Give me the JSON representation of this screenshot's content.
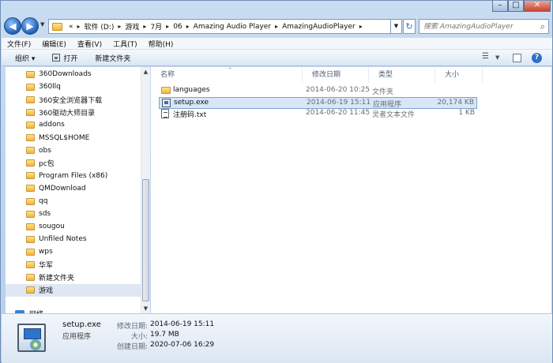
{
  "window": {
    "controls": {
      "minimize": "–",
      "maximize": "□",
      "close": "✕"
    }
  },
  "address": {
    "prefix": "«",
    "crumbs": [
      "软件 (D:)",
      "游戏",
      "7月",
      "06",
      "Amazing Audio Player",
      "AmazingAudioPlayer"
    ],
    "separator": "▸"
  },
  "search": {
    "placeholder": "搜索 AmazingAudioPlayer"
  },
  "menu": [
    "文件(F)",
    "编辑(E)",
    "查看(V)",
    "工具(T)",
    "帮助(H)"
  ],
  "toolbar": {
    "organize": "组织 ▾",
    "open": "打开",
    "new_folder": "新建文件夹"
  },
  "nav": {
    "items": [
      "360Downloads",
      "360llq",
      "360安全浏览器下载",
      "360驱动大师目录",
      "addons",
      "MSSQL$HOME",
      "obs",
      "pc包",
      "Program Files (x86)",
      "QMDownload",
      "qq",
      "sds",
      "sougou",
      "Unfiled Notes",
      "wps",
      "华军",
      "新建文件夹",
      "游戏"
    ],
    "selected_index": 17,
    "network": "网络"
  },
  "columns": {
    "name": "名称",
    "date": "修改日期",
    "type": "类型",
    "size": "大小"
  },
  "files": [
    {
      "icon": "folder-icon",
      "name": "languages",
      "date": "2014-06-20 10:25",
      "type": "文件夹",
      "size": ""
    },
    {
      "icon": "exe-icon",
      "name": "setup.exe",
      "date": "2014-06-19 15:11",
      "type": "应用程序",
      "size": "20,174 KB"
    },
    {
      "icon": "text-file-icon",
      "name": "注册码.txt",
      "date": "2014-06-20 11:45",
      "type": "灵者文本文件",
      "size": "1 KB"
    }
  ],
  "selected_file_index": 1,
  "details": {
    "name": "setup.exe",
    "type": "应用程序",
    "modified_label": "修改日期:",
    "modified": "2014-06-19 15:11",
    "size_label": "大小:",
    "size": "19.7 MB",
    "created_label": "创建日期:",
    "created": "2020-07-06 16:29"
  }
}
